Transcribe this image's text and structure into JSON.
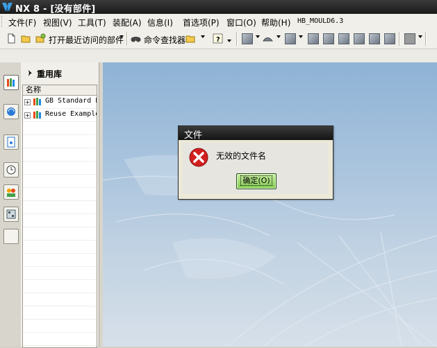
{
  "window": {
    "title": "NX 8 - [没有部件]"
  },
  "menubar": {
    "items": [
      "文件(F)",
      "视图(V)",
      "工具(T)",
      "装配(A)",
      "信息(I)",
      "首选项(P)",
      "窗口(O)",
      "帮助(H)",
      "HB_MOULD6.3"
    ]
  },
  "toolbar": {
    "recent_parts_label": "打开最近访问的部件",
    "command_finder_label": "命令查找器"
  },
  "reuse_library": {
    "title": "重用库",
    "column_header": "名称",
    "items": [
      "GB Standard P",
      "Reuse Example"
    ]
  },
  "dialog": {
    "title": "文件",
    "message": "无效的文件名",
    "ok_label": "确定(O)"
  },
  "colors": {
    "titlebar": "#1a1a1a",
    "graphics_top": "#8fb3d6",
    "graphics_bottom": "#d6e0ea",
    "ok_button": "#7fc94f",
    "error_icon": "#d21f1f"
  }
}
